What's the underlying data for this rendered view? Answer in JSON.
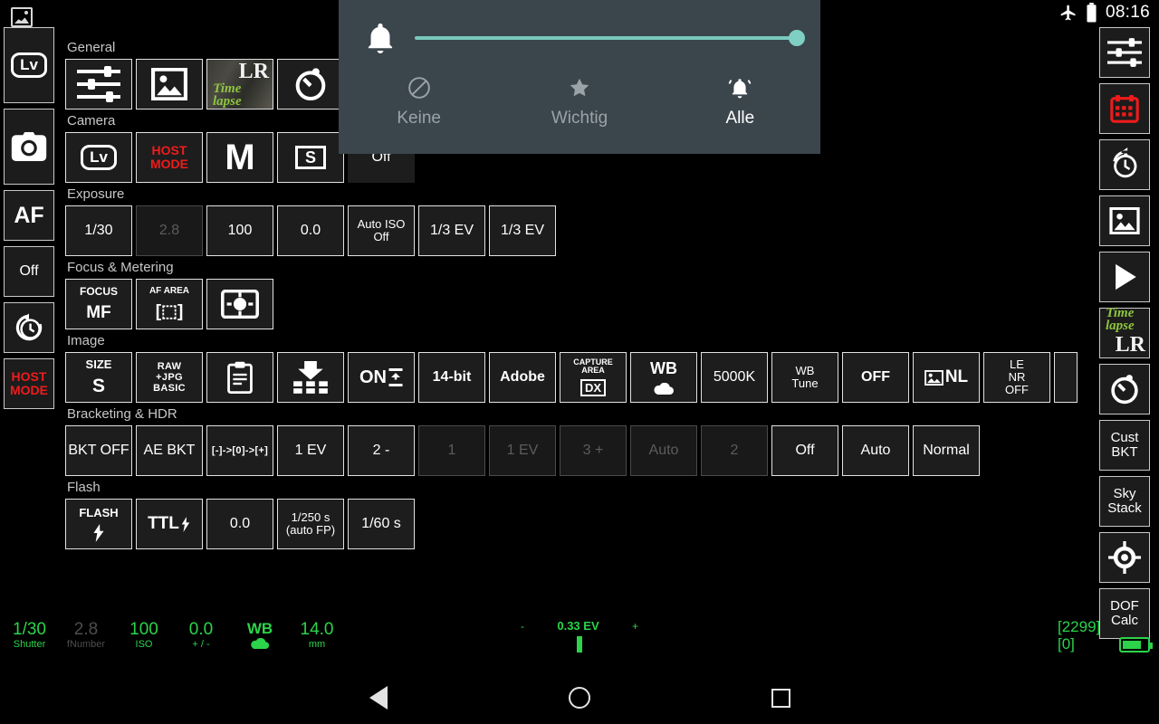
{
  "statusbar": {
    "time": "08:16",
    "airplane_icon": "airplane-icon",
    "battery_icon": "battery-icon"
  },
  "app_icon": "gallery-image-icon",
  "volume_panel": {
    "bell_icon": "notification-bell-icon",
    "slider_value_percent": 100,
    "accent_color": "#7fcfc4",
    "modes": [
      {
        "icon": "do-not-disturb-icon",
        "label": "Keine",
        "active": false
      },
      {
        "icon": "star-icon",
        "label": "Wichtig",
        "active": false
      },
      {
        "icon": "bell-ringing-icon",
        "label": "Alle",
        "active": true
      }
    ]
  },
  "left_rail": [
    {
      "name": "live-view",
      "label": "Lv",
      "icon": "lv-icon",
      "tall": true
    },
    {
      "name": "camera",
      "label": "",
      "icon": "camera-icon",
      "tall": true
    },
    {
      "name": "autofocus",
      "label": "AF",
      "icon": "",
      "tall": false
    },
    {
      "name": "off",
      "label": "Off",
      "icon": "",
      "tall": false
    },
    {
      "name": "intervalometer",
      "label": "",
      "icon": "time-rotate-icon",
      "tall": false
    },
    {
      "name": "host-mode",
      "label": "HOST MODE",
      "icon": "",
      "tall": false,
      "color": "#ef1b1b"
    }
  ],
  "right_rail": [
    {
      "name": "settings-sliders",
      "label": "",
      "icon": "sliders-icon"
    },
    {
      "name": "calendar-schedule",
      "label": "",
      "icon": "calendar-icon",
      "color": "#ef1b1b"
    },
    {
      "name": "time-rotate",
      "label": "",
      "icon": "time-rotate-icon"
    },
    {
      "name": "gallery",
      "label": "",
      "icon": "image-icon"
    },
    {
      "name": "play",
      "label": "",
      "icon": "play-icon"
    },
    {
      "name": "lr-timelapse",
      "label": "LR Time lapse",
      "icon": "lrtimelapse-thumb"
    },
    {
      "name": "timer",
      "label": "",
      "icon": "timer-icon"
    },
    {
      "name": "cust-bkt",
      "label": "Cust\nBKT",
      "icon": ""
    },
    {
      "name": "sky-stack",
      "label": "Sky\nStack",
      "icon": ""
    },
    {
      "name": "focus-target",
      "label": "",
      "icon": "crosshair-icon"
    },
    {
      "name": "dof-calc",
      "label": "DOF\nCalc",
      "icon": ""
    }
  ],
  "groups": [
    {
      "title": "General",
      "tiles": [
        {
          "name": "general-settings",
          "label": "",
          "icon": "sliders-icon"
        },
        {
          "name": "general-gallery",
          "label": "",
          "icon": "image-icon"
        },
        {
          "name": "general-lrtimelapse",
          "label": "",
          "icon": "lrtimelapse-thumb"
        },
        {
          "name": "general-timer",
          "label": "",
          "icon": "timer-icon"
        }
      ]
    },
    {
      "title": "Camera",
      "tiles": [
        {
          "name": "camera-liveview",
          "label": "Lv",
          "icon": "lv-icon"
        },
        {
          "name": "camera-host-mode",
          "label": "HOST MODE",
          "style": "host"
        },
        {
          "name": "camera-mode-m",
          "label": "M",
          "style": "big"
        },
        {
          "name": "camera-release-s",
          "label": "S",
          "icon": "boxed-s-icon"
        },
        {
          "name": "camera-off",
          "label": "Off",
          "style": "noborder"
        }
      ]
    },
    {
      "title": "Exposure",
      "tiles": [
        {
          "name": "exposure-shutter",
          "label": "1/30"
        },
        {
          "name": "exposure-aperture",
          "label": "2.8",
          "dim": true
        },
        {
          "name": "exposure-iso",
          "label": "100"
        },
        {
          "name": "exposure-compensation",
          "label": "0.0"
        },
        {
          "name": "exposure-auto-iso",
          "label": "Auto ISO\nOff",
          "style": "small"
        },
        {
          "name": "exposure-step-1",
          "label": "1/3 EV"
        },
        {
          "name": "exposure-step-2",
          "label": "1/3 EV"
        }
      ]
    },
    {
      "title": "Focus & Metering",
      "tiles": [
        {
          "name": "focus-mode",
          "label": "FOCUS\nMF",
          "style": "stack"
        },
        {
          "name": "af-area-mode",
          "label": "AF AREA\n[ ]",
          "style": "stack"
        },
        {
          "name": "metering-mode",
          "label": "",
          "icon": "metering-icon"
        }
      ]
    },
    {
      "title": "Image",
      "tiles": [
        {
          "name": "image-size",
          "label": "SIZE\nS",
          "style": "stack"
        },
        {
          "name": "image-quality",
          "label": "RAW\n+JPG\nBASIC",
          "style": "xsmall"
        },
        {
          "name": "image-clipboard",
          "label": "",
          "icon": "clipboard-icon"
        },
        {
          "name": "image-download-grid",
          "label": "",
          "icon": "download-grid-icon"
        },
        {
          "name": "image-on-save",
          "label": "ON",
          "icon": "on-save-icon"
        },
        {
          "name": "image-bit-depth",
          "label": "14-bit",
          "style": "bold"
        },
        {
          "name": "image-color-space",
          "label": "Adobe",
          "style": "bold"
        },
        {
          "name": "image-capture-area",
          "label": "CAPTURE AREA\nDX",
          "style": "capture"
        },
        {
          "name": "image-white-balance",
          "label": "WB",
          "icon": "cloud-icon"
        },
        {
          "name": "image-kelvin",
          "label": "5000K"
        },
        {
          "name": "image-wb-tune",
          "label": "WB\nTune",
          "style": "small"
        },
        {
          "name": "image-active-dlighting",
          "label": "OFF",
          "style": "bold"
        },
        {
          "name": "image-picture-control",
          "label": "NL",
          "icon": "picture-control-icon"
        },
        {
          "name": "image-long-exposure-nr",
          "label": "LE\nNR\nOFF",
          "style": "small"
        },
        {
          "name": "image-more",
          "label": "",
          "style": "cut"
        }
      ]
    },
    {
      "title": "Bracketing & HDR",
      "tiles": [
        {
          "name": "bracketing-state",
          "label": "BKT OFF"
        },
        {
          "name": "bracketing-type",
          "label": "AE BKT"
        },
        {
          "name": "bracketing-order",
          "label": "[-]->[0]->[+]",
          "style": "xsmall"
        },
        {
          "name": "bracketing-step",
          "label": "1 EV"
        },
        {
          "name": "bracketing-count",
          "label": "2 -"
        },
        {
          "name": "bracketing-extra-1",
          "label": "1",
          "dim": true
        },
        {
          "name": "bracketing-extra-2",
          "label": "1 EV",
          "dim": true
        },
        {
          "name": "bracketing-extra-3",
          "label": "3 +",
          "dim": true
        },
        {
          "name": "bracketing-extra-4",
          "label": "Auto",
          "dim": true
        },
        {
          "name": "bracketing-extra-5",
          "label": "2",
          "dim": true
        },
        {
          "name": "hdr-mode",
          "label": "Off"
        },
        {
          "name": "hdr-strength",
          "label": "Auto"
        },
        {
          "name": "hdr-smoothing",
          "label": "Normal"
        }
      ]
    },
    {
      "title": "Flash",
      "tiles": [
        {
          "name": "flash-toggle",
          "label": "FLASH",
          "icon": "flash-bolt-icon"
        },
        {
          "name": "flash-mode",
          "label": "TTL",
          "icon": "flash-ttl-icon"
        },
        {
          "name": "flash-compensation",
          "label": "0.0"
        },
        {
          "name": "flash-sync-speed",
          "label": "1/250 s\n(auto FP)",
          "style": "small"
        },
        {
          "name": "flash-slowest-speed",
          "label": "1/60 s"
        }
      ]
    }
  ],
  "bottom_status": [
    {
      "name": "shutter",
      "value": "1/30",
      "key": "Shutter",
      "dim": false
    },
    {
      "name": "fnumber",
      "value": "2.8",
      "key": "fNumber",
      "dim": true
    },
    {
      "name": "iso",
      "value": "100",
      "key": "ISO",
      "dim": false
    },
    {
      "name": "exposure-comp",
      "value": "0.0",
      "key": "+ / -",
      "dim": false
    },
    {
      "name": "white-balance",
      "value": "WB",
      "key": "cloud-icon",
      "dim": false
    },
    {
      "name": "focal-length",
      "value": "14.0",
      "key": "mm",
      "dim": false
    }
  ],
  "ev_meter": {
    "minus": "-",
    "value": "0.33 EV",
    "plus": "+"
  },
  "frame_counts": {
    "remaining": "[2299]",
    "taken": "[0]"
  },
  "navbar": {
    "back": "back-icon",
    "home": "home-icon",
    "recent": "recent-apps-icon"
  }
}
